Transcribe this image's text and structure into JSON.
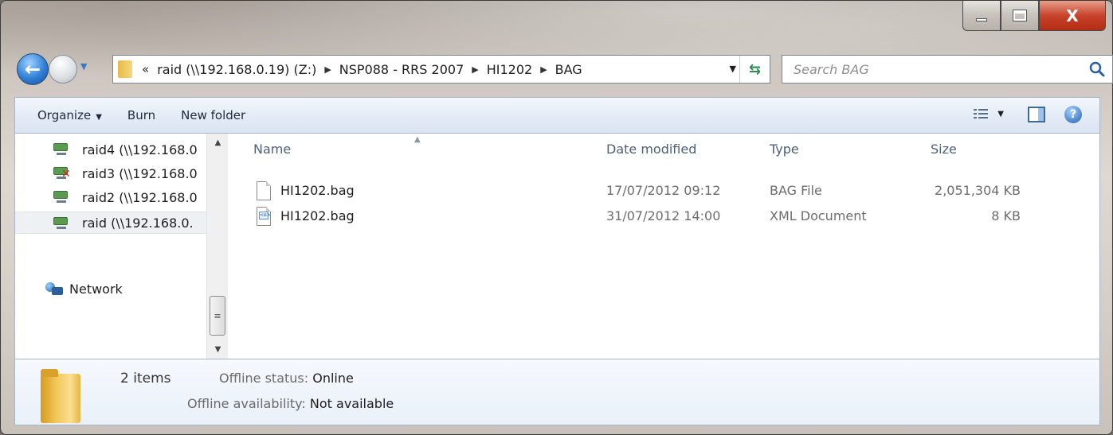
{
  "window": {
    "minimize_label": "–",
    "maximize_label": "□",
    "close_label": "X"
  },
  "nav": {
    "back_glyph": "←",
    "address": {
      "overflow": "«",
      "crumbs": [
        "raid (\\\\192.168.0.19) (Z:)",
        "NSP088 - RRS 2007",
        "HI1202",
        "BAG"
      ],
      "separator": "▶"
    },
    "search_placeholder": "Search BAG"
  },
  "commandbar": {
    "organize": "Organize",
    "burn": "Burn",
    "new_folder": "New folder"
  },
  "navpane": {
    "items": [
      {
        "label": "raid4 (\\\\192.168.0",
        "status": "connected"
      },
      {
        "label": "raid3 (\\\\192.168.0",
        "status": "disconnected"
      },
      {
        "label": "raid2 (\\\\192.168.0",
        "status": "connected"
      },
      {
        "label": "raid (\\\\192.168.0.",
        "status": "connected",
        "selected": true
      }
    ],
    "network": "Network"
  },
  "filelist": {
    "columns": {
      "name": "Name",
      "date": "Date modified",
      "type": "Type",
      "size": "Size"
    },
    "rows": [
      {
        "name": "HI1202.bag",
        "date": "17/07/2012 09:12",
        "type": "BAG File",
        "size": "2,051,304 KB",
        "icon": "generic-file-icon"
      },
      {
        "name": "HI1202.bag",
        "date": "31/07/2012 14:00",
        "type": "XML Document",
        "size": "8 KB",
        "icon": "xml-file-icon"
      }
    ]
  },
  "details": {
    "count": "2 items",
    "offline_status_key": "Offline status:",
    "offline_status_val": "Online",
    "offline_avail_key": "Offline availability:",
    "offline_avail_val": "Not available"
  },
  "colors": {
    "accent": "#2f7fd6",
    "status_ok": "#5a9b4f",
    "status_error": "#d9261c"
  }
}
